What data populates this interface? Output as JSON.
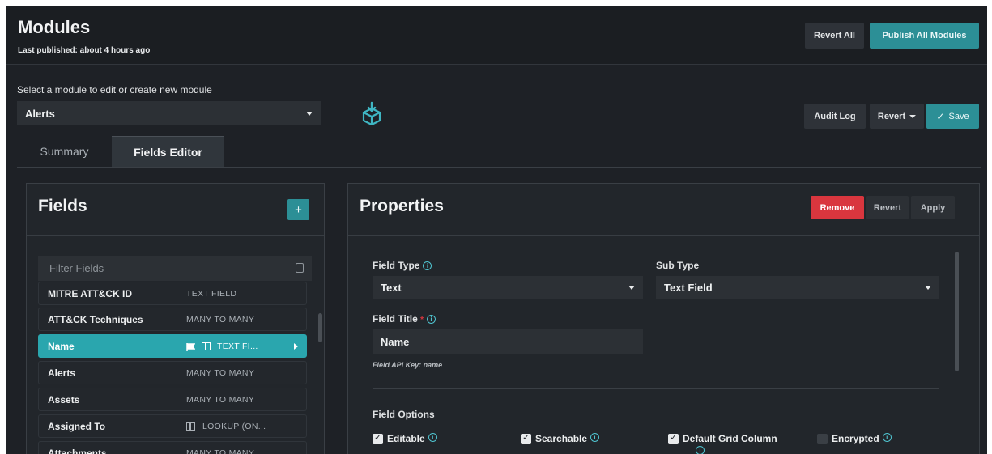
{
  "header": {
    "title": "Modules",
    "subtitle": "Last published: about 4 hours ago",
    "revert_all": "Revert All",
    "publish_all": "Publish All Modules"
  },
  "module_select": {
    "label": "Select a module to edit or create new module",
    "value": "Alerts"
  },
  "toolbar": {
    "audit_log": "Audit Log",
    "revert": "Revert",
    "save": "Save"
  },
  "tabs": [
    {
      "label": "Summary",
      "active": false
    },
    {
      "label": "Fields Editor",
      "active": true
    }
  ],
  "fields_panel": {
    "title": "Fields",
    "add_label": "+",
    "filter_placeholder": "Filter Fields",
    "items": [
      {
        "name": "MITRE ATT&CK ID",
        "type": "TEXT FIELD"
      },
      {
        "name": "ATT&CK Techniques",
        "type": "MANY TO MANY"
      },
      {
        "name": "Name",
        "type": "TEXT FI...",
        "selected": true
      },
      {
        "name": "Alerts",
        "type": "MANY TO MANY"
      },
      {
        "name": "Assets",
        "type": "MANY TO MANY"
      },
      {
        "name": "Assigned To",
        "type": "LOOKUP (ON..."
      },
      {
        "name": "Attachments",
        "type": "MANY TO MANY"
      }
    ]
  },
  "properties_panel": {
    "title": "Properties",
    "remove": "Remove",
    "revert": "Revert",
    "apply": "Apply",
    "field_type_label": "Field Type",
    "field_type_value": "Text",
    "sub_type_label": "Sub Type",
    "sub_type_value": "Text Field",
    "field_title_label": "Field Title",
    "required_mark": "*",
    "field_title_value": "Name",
    "api_key": "Field API Key: name",
    "options_label": "Field Options",
    "options": [
      {
        "label": "Editable",
        "checked": true
      },
      {
        "label": "Searchable",
        "checked": true
      },
      {
        "label": "Default Grid Column",
        "checked": true
      },
      {
        "label": "Encrypted",
        "checked": false
      }
    ]
  },
  "colors": {
    "accent": "#2aa6ae",
    "danger": "#d9363e",
    "background": "#1e2126"
  }
}
